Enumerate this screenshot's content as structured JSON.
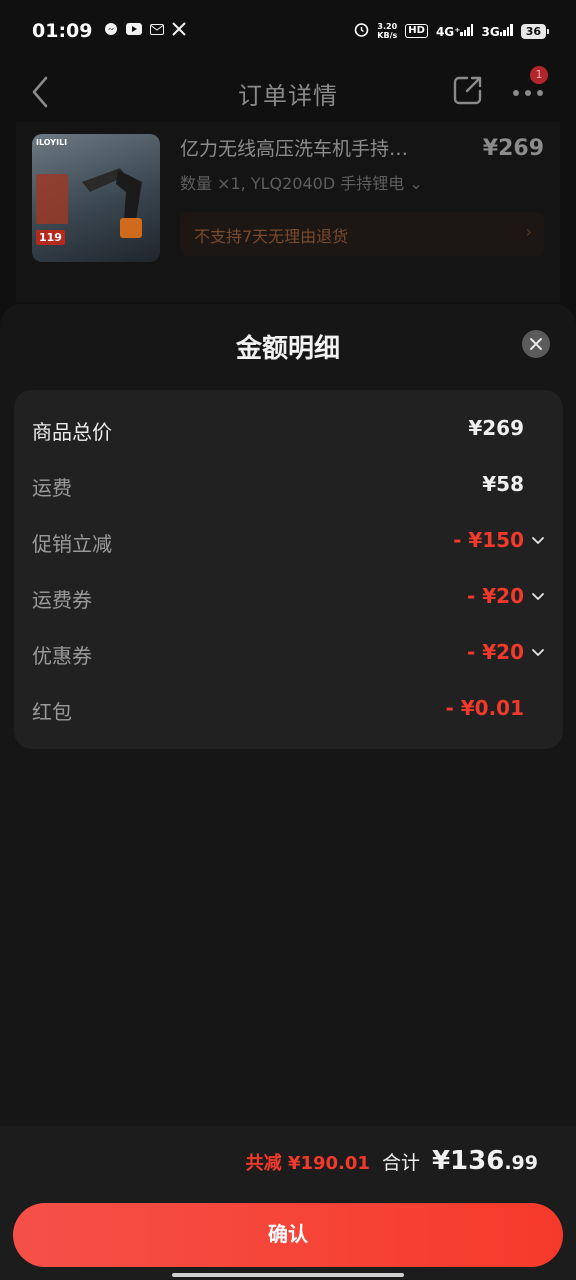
{
  "status_bar": {
    "time": "01:09",
    "net_speed_value": "3.20",
    "net_speed_unit": "KB/s",
    "hd": "HD",
    "signal1": "4G⁺",
    "signal2": "3G",
    "battery": "36",
    "icons": [
      "messenger-icon",
      "youtube-icon",
      "gmail-icon",
      "x-icon",
      "alarm-icon"
    ]
  },
  "nav": {
    "title": "订单详情",
    "badge": "1"
  },
  "product": {
    "title": "亿力无线高压洗车机手持…",
    "price": "¥269",
    "spec": "数量 ×1, YLQ2040D 手持锂电 ⌄",
    "notice": "不支持7天无理由退货",
    "notice_chevron": "›",
    "image_brand": "ILOYILI",
    "image_tag": "119"
  },
  "sheet": {
    "title": "金额明细",
    "rows": [
      {
        "label": "商品总价",
        "value": "¥269"
      },
      {
        "label": "运费",
        "value": "¥58"
      },
      {
        "label": "促销立减",
        "value": "- ¥150"
      },
      {
        "label": "运费券",
        "value": "- ¥20"
      },
      {
        "label": "优惠券",
        "value": "- ¥20"
      },
      {
        "label": "红包",
        "value": "- ¥0.01"
      }
    ]
  },
  "summary": {
    "saved": "共减 ¥190.01",
    "total_label": "合计",
    "total_main": "¥136",
    "total_decimal": ".99"
  },
  "confirm_label": "确认",
  "colors": {
    "accent": "#f23a2c",
    "button_gradient_start": "#f55048",
    "button_gradient_end": "#f63a2a",
    "sheet_bg": "#161616",
    "card_bg": "#212121"
  }
}
